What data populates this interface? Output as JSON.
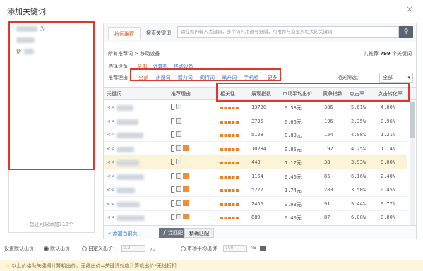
{
  "dialog": {
    "title": "添加关键词",
    "close_glyph": "×"
  },
  "left_panel": {
    "items": [
      {
        "label": "为"
      },
      {
        "label": ""
      },
      {
        "label": "帮"
      }
    ],
    "footer": "您还可以添加113个"
  },
  "tabs": [
    {
      "label": "按词推荐",
      "active": true
    },
    {
      "label": "搜索关键词",
      "active": false
    }
  ],
  "search": {
    "placeholder": "请在框内输入关键词，多个词可用逗号分隔，可推荐与您宝贝相关的关键词"
  },
  "breadcrumb": {
    "root": "所有推荐词",
    "sep": ">",
    "current": "移动设备"
  },
  "total": {
    "prefix": "共推荐",
    "count": "799",
    "suffix": "个关键词"
  },
  "device_filter": {
    "label": "选择设备：",
    "options": [
      "全部",
      "计算机",
      "移动设备"
    ]
  },
  "recommend": {
    "label": "推荐理由：",
    "options": [
      "全部",
      "热搜词",
      "潜力词",
      "同行词",
      "飙升词",
      "手机标"
    ],
    "more": "更多"
  },
  "relevance": {
    "label": "相关筛选：",
    "value": "全部"
  },
  "table": {
    "columns": [
      "关键词",
      "推荐理由",
      "相关性",
      "展现指数",
      "市场平均出价",
      "竞争指数",
      "点击率",
      "点击转化率"
    ],
    "rows": [
      {
        "kw": "<<",
        "relevance": 5,
        "impr": "13730",
        "bid": "0.58元",
        "comp": "386",
        "ctr": "5.61%",
        "cvr": "4.00%",
        "highlight": false
      },
      {
        "kw": "<<",
        "relevance": 5,
        "impr": "3735",
        "bid": "0.66元",
        "comp": "196",
        "ctr": "2.35%",
        "cvr": "0.96%",
        "highlight": false
      },
      {
        "kw": "<<",
        "relevance": 5,
        "impr": "5128",
        "bid": "0.89元",
        "comp": "154",
        "ctr": "4.08%",
        "cvr": "1.21%",
        "highlight": false
      },
      {
        "kw": "<<",
        "relevance": 5,
        "impr": "10284",
        "bid": "0.85元",
        "comp": "192",
        "ctr": "4.25%",
        "cvr": "1.14%",
        "highlight": false
      },
      {
        "kw": "<<",
        "relevance": 5,
        "impr": "448",
        "bid": "1.17元",
        "comp": "38",
        "ctr": "3.93%",
        "cvr": "0.00%",
        "highlight": true
      },
      {
        "kw": "<<",
        "relevance": 5,
        "impr": "1164",
        "bid": "0.46元",
        "comp": "85",
        "ctr": "6.16%",
        "cvr": "2.40%",
        "highlight": false
      },
      {
        "kw": "<<",
        "relevance": 5,
        "impr": "5222",
        "bid": "1.74元",
        "comp": "283",
        "ctr": "3.50%",
        "cvr": "0.45%",
        "highlight": false
      },
      {
        "kw": "<<",
        "relevance": 5,
        "impr": "2456",
        "bid": "0.93元",
        "comp": "91",
        "ctr": "5.44%",
        "cvr": "0.77%",
        "highlight": false
      },
      {
        "kw": "<<",
        "relevance": 5,
        "impr": "889",
        "bid": "0.40元",
        "comp": "87",
        "ctr": "6.08%",
        "cvr": "0.00%",
        "highlight": false
      }
    ]
  },
  "footer_bar": {
    "add_all": "添加当前页",
    "broad": "广泛匹配",
    "exact": "精确匹配"
  },
  "bid_settings": {
    "label": "设置默认出价：",
    "opt_default": "默认出价",
    "opt_custom": "自定义出价：",
    "custom_value": "0.2",
    "unit": "元",
    "opt_market": "市场平均出价",
    "times": "×",
    "market_value": "100",
    "percent": "%"
  },
  "info": {
    "text": "以上价格为关键词计算机出价，无线出价=关键词对应计算机出价*无线折扣"
  }
}
